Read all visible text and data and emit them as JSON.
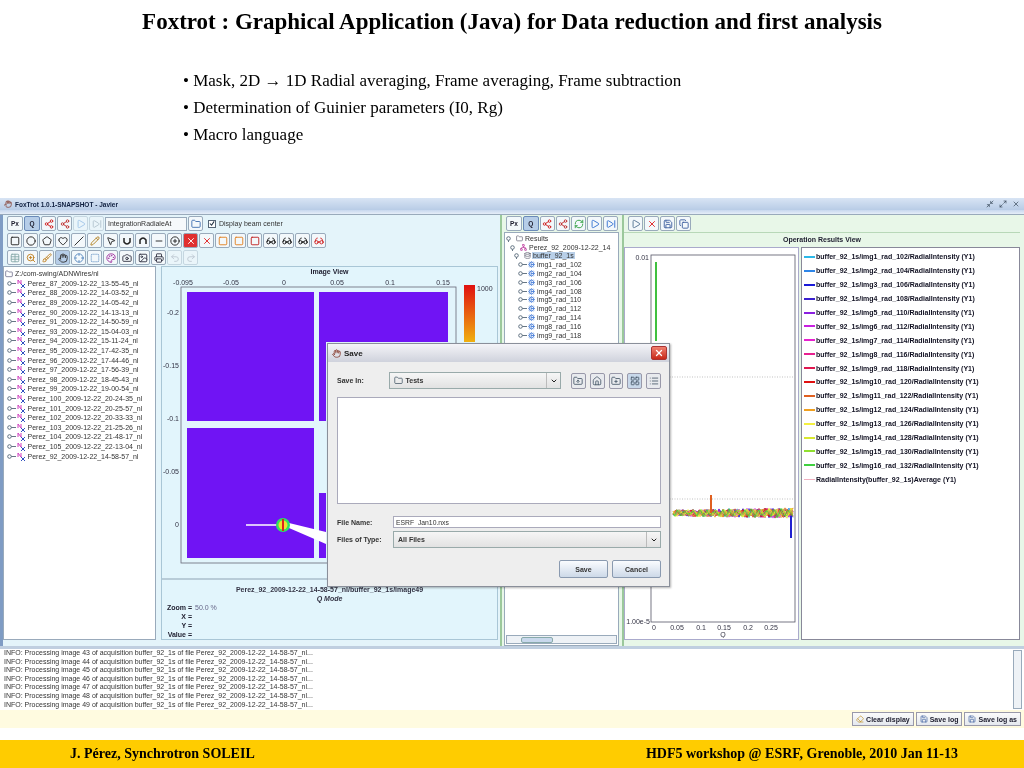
{
  "slide": {
    "title": "Foxtrot : Graphical Application (Java) for Data reduction and first analysis",
    "bullets": [
      "• Mask, 2D **→** 1D Radial averaging, Frame averaging, Frame subtraction",
      "• Determination of Guinier parameters (I0, Rg)",
      "• Macro language"
    ],
    "footer": {
      "left": "J. Pérez, Synchrotron SOLEIL",
      "right": "HDF5 workshop @ ESRF, Grenoble, 2010 Jan 11-13"
    }
  },
  "window": {
    "title": "FoxTrot 1.0.1-SNAPSHOT - Javier"
  },
  "image_toolbar": {
    "mode_buttons": [
      {
        "label": "Px",
        "selected": false
      },
      {
        "label": "Q",
        "selected": true
      }
    ],
    "integration_field": "IntegrationRadialeAt",
    "beam_center": {
      "label": "Display beam center",
      "checked": true
    }
  },
  "file_tree": {
    "root": "Z:/com-swing/ADNWires/nl",
    "items": [
      {
        "label": "Perez_87_2009-12-22_13-55-45_nl",
        "expanded": false
      },
      {
        "label": "Perez_88_2009-12-22_14-03-52_nl",
        "expanded": false
      },
      {
        "label": "Perez_89_2009-12-22_14-05-42_nl",
        "expanded": false
      },
      {
        "label": "Perez_90_2009-12-22_14-13-13_nl",
        "expanded": false
      },
      {
        "label": "Perez_91_2009-12-22_14-50-59_nl",
        "expanded": false
      },
      {
        "label": "Perez_93_2009-12-22_15-04-03_nl",
        "expanded": false
      },
      {
        "label": "Perez_94_2009-12-22_15-11-24_nl",
        "expanded": false
      },
      {
        "label": "Perez_95_2009-12-22_17-42-35_nl",
        "expanded": false
      },
      {
        "label": "Perez_96_2009-12-22_17-44-46_nl",
        "expanded": false
      },
      {
        "label": "Perez_97_2009-12-22_17-56-39_nl",
        "expanded": false
      },
      {
        "label": "Perez_98_2009-12-22_18-45-43_nl",
        "expanded": false
      },
      {
        "label": "Perez_99_2009-12-22_19-00-54_nl",
        "expanded": false
      },
      {
        "label": "Perez_100_2009-12-22_20-24-35_nl",
        "expanded": false
      },
      {
        "label": "Perez_101_2009-12-22_20-25-57_nl",
        "expanded": false
      },
      {
        "label": "Perez_102_2009-12-22_20-33-33_nl",
        "expanded": false
      },
      {
        "label": "Perez_103_2009-12-22_21-25-26_nl",
        "expanded": false
      },
      {
        "label": "Perez_104_2009-12-22_21-48-17_nl",
        "expanded": false
      },
      {
        "label": "Perez_105_2009-12-22_22-13-04_nl",
        "expanded": false
      },
      {
        "label": "Perez_92_2009-12-22_14-58-57_nl",
        "expanded": false
      }
    ]
  },
  "image_view": {
    "title": "Image View",
    "x_ticks": [
      "-0.095",
      "-0.05",
      "0",
      "0.05",
      "0.1",
      "0.15"
    ],
    "y_ticks": [
      "-0.2",
      "-0.15",
      "-0.1",
      "-0.05",
      "0"
    ],
    "colorbar_max": "1000",
    "file": "Perez_92_2009-12-22_14-58-57_nl/buffer_92_1s/image49",
    "mode": "Q Mode",
    "zoom_label": "Zoom =",
    "zoom_value": "50.0 %",
    "x_label": "X =",
    "y_label": "Y =",
    "value_label": "Value ="
  },
  "results_toolbar": {
    "mode_buttons": [
      {
        "label": "Px",
        "selected": false
      },
      {
        "label": "Q",
        "selected": true
      }
    ]
  },
  "results_tree": {
    "nodes": [
      {
        "label": "Results",
        "expanded": true,
        "selected": false,
        "children": [
          {
            "label": "Perez_92_2009-12-22_14",
            "expanded": true,
            "selected": false,
            "children": [
              {
                "label": "buffer_92_1s",
                "expanded": true,
                "selected": true,
                "children": [
                  {
                    "label": "img1_rad_102",
                    "expanded": false,
                    "selected": false
                  },
                  {
                    "label": "img2_rad_104",
                    "expanded": false,
                    "selected": false
                  },
                  {
                    "label": "img3_rad_106",
                    "expanded": false,
                    "selected": false
                  },
                  {
                    "label": "img4_rad_108",
                    "expanded": false,
                    "selected": false
                  },
                  {
                    "label": "img5_rad_110",
                    "expanded": false,
                    "selected": false
                  },
                  {
                    "label": "img6_rad_112",
                    "expanded": false,
                    "selected": false
                  },
                  {
                    "label": "img7_rad_114",
                    "expanded": false,
                    "selected": false
                  },
                  {
                    "label": "img8_rad_116",
                    "expanded": false,
                    "selected": false
                  },
                  {
                    "label": "img9_rad_118",
                    "expanded": false,
                    "selected": false
                  }
                ]
              }
            ]
          }
        ]
      }
    ]
  },
  "results_view": {
    "title": "Operation Results View",
    "y_ticks": [
      "0.01",
      "1.00e-5"
    ],
    "x_ticks": [
      "0",
      "0.05",
      "0.1",
      "0.15",
      "0.2",
      "0.25"
    ],
    "xlabel": "Q",
    "legend": [
      {
        "label": "buffer_92_1s/img1_rad_102/RadialIntensity (Y1)",
        "color": "#2cb8e8"
      },
      {
        "label": "buffer_92_1s/img2_rad_104/RadialIntensity (Y1)",
        "color": "#2e86e8"
      },
      {
        "label": "buffer_92_1s/img3_rad_106/RadialIntensity (Y1)",
        "color": "#1a1ad8"
      },
      {
        "label": "buffer_92_1s/img4_rad_108/RadialIntensity (Y1)",
        "color": "#3a20d0"
      },
      {
        "label": "buffer_92_1s/img5_rad_110/RadialIntensity (Y1)",
        "color": "#8a20e0"
      },
      {
        "label": "buffer_92_1s/img6_rad_112/RadialIntensity (Y1)",
        "color": "#c820e0"
      },
      {
        "label": "buffer_92_1s/img7_rad_114/RadialIntensity (Y1)",
        "color": "#e820d0"
      },
      {
        "label": "buffer_92_1s/img8_rad_116/RadialIntensity (Y1)",
        "color": "#e82090"
      },
      {
        "label": "buffer_92_1s/img9_rad_118/RadialIntensity (Y1)",
        "color": "#e01850"
      },
      {
        "label": "buffer_92_1s/img10_rad_120/RadialIntensity (Y1)",
        "color": "#e01010"
      },
      {
        "label": "buffer_92_1s/img11_rad_122/RadialIntensity (Y1)",
        "color": "#e06020"
      },
      {
        "label": "buffer_92_1s/img12_rad_124/RadialIntensity (Y1)",
        "color": "#f0a020"
      },
      {
        "label": "buffer_92_1s/img13_rad_126/RadialIntensity (Y1)",
        "color": "#f4f040"
      },
      {
        "label": "buffer_92_1s/img14_rad_128/RadialIntensity (Y1)",
        "color": "#d8e830"
      },
      {
        "label": "buffer_92_1s/img15_rad_130/RadialIntensity (Y1)",
        "color": "#90e030"
      },
      {
        "label": "buffer_92_1s/img16_rad_132/RadialIntensity (Y1)",
        "color": "#40d040"
      },
      {
        "label": "RadialIntensity(buffer_92_1s)Average (Y1)",
        "color": "#f0b0c0"
      }
    ]
  },
  "log": {
    "lines": [
      "INFO: Processing image 43 of acquisition buffer_92_1s of file Perez_92_2009-12-22_14-58-57_nl...",
      "INFO: Processing image 44 of acquisition buffer_92_1s of file Perez_92_2009-12-22_14-58-57_nl...",
      "INFO: Processing image 45 of acquisition buffer_92_1s of file Perez_92_2009-12-22_14-58-57_nl...",
      "INFO: Processing image 46 of acquisition buffer_92_1s of file Perez_92_2009-12-22_14-58-57_nl...",
      "INFO: Processing image 47 of acquisition buffer_92_1s of file Perez_92_2009-12-22_14-58-57_nl...",
      "INFO: Processing image 48 of acquisition buffer_92_1s of file Perez_92_2009-12-22_14-58-57_nl...",
      "INFO: Processing image 49 of acquisition buffer_92_1s of file Perez_92_2009-12-22_14-58-57_nl..."
    ],
    "buttons": [
      "Clear display",
      "Save log",
      "Save log as"
    ]
  },
  "save_dialog": {
    "title": "Save",
    "save_in_label": "Save In:",
    "save_in": "Tests",
    "file_name_label": "File Name:",
    "file_name": "ESRF_Jan10.nxs",
    "files_of_type_label": "Files of Type:",
    "files_of_type": "All Files",
    "buttons": [
      "Save",
      "Cancel"
    ]
  }
}
